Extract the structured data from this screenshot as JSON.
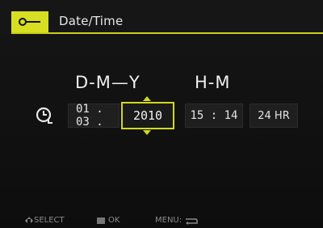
{
  "header": {
    "title": "Date/Time",
    "tab_icon": "key-tab-icon",
    "accent_color": "#d2d81e"
  },
  "headings": {
    "date_format": "D-M—Y",
    "time_format": "H-M"
  },
  "fields": {
    "clock_icon": "clock-icon",
    "date": "01 . 03 .",
    "year": "2010",
    "time": "15 : 14",
    "hour_mode": "24 HR"
  },
  "footer": {
    "select_label": "SELECT",
    "ok_label": "OK",
    "menu_label": "MENU:"
  }
}
